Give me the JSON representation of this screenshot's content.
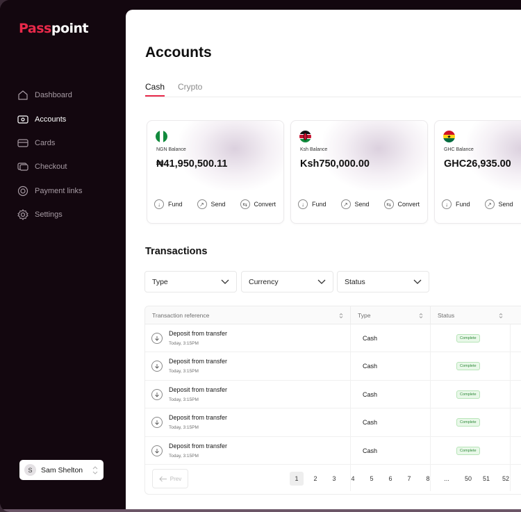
{
  "brand": {
    "logo_accent": "Pass",
    "logo_rest": "point",
    "accent_color": "#e8294a"
  },
  "sidebar": {
    "items": [
      {
        "label": "Dashboard",
        "icon": "home-icon"
      },
      {
        "label": "Accounts",
        "icon": "wallet-icon",
        "active": true
      },
      {
        "label": "Cards",
        "icon": "card-icon"
      },
      {
        "label": "Checkout",
        "icon": "checkout-icon"
      },
      {
        "label": "Payment links",
        "icon": "link-icon"
      },
      {
        "label": "Settings",
        "icon": "gear-icon"
      }
    ],
    "user": {
      "initial": "S",
      "name": "Sam Shelton"
    }
  },
  "main": {
    "title": "Accounts",
    "tabs": [
      {
        "label": "Cash",
        "active": true
      },
      {
        "label": "Crypto"
      }
    ],
    "cards": [
      {
        "flag": "nigeria-flag-icon",
        "label": "NGN Balance",
        "amount": "₦41,950,500.11",
        "actions": [
          "Fund",
          "Send",
          "Convert"
        ]
      },
      {
        "flag": "kenya-flag-icon",
        "label": "Ksh Balance",
        "amount": "Ksh750,000.00",
        "actions": [
          "Fund",
          "Send",
          "Convert"
        ]
      },
      {
        "flag": "ghana-flag-icon",
        "label": "GHC Balance",
        "amount": "GHC26,935.00",
        "actions": [
          "Fund",
          "Send"
        ]
      }
    ],
    "transactions": {
      "title": "Transactions",
      "filters": [
        "Type",
        "Currency",
        "Status"
      ],
      "columns": [
        "Transaction reference",
        "Type",
        "Status"
      ],
      "rows": [
        {
          "desc": "Deposit from transfer",
          "when": "Today, 3:15PM",
          "type": "Cash",
          "status": "Complete"
        },
        {
          "desc": "Deposit from transfer",
          "when": "Today, 3:15PM",
          "type": "Cash",
          "status": "Complete"
        },
        {
          "desc": "Deposit from transfer",
          "when": "Today, 3:15PM",
          "type": "Cash",
          "status": "Complete"
        },
        {
          "desc": "Deposit from transfer",
          "when": "Today, 3:15PM",
          "type": "Cash",
          "status": "Complete"
        },
        {
          "desc": "Deposit from transfer",
          "when": "Today, 3:15PM",
          "type": "Cash",
          "status": "Complete"
        }
      ],
      "pager": {
        "prev_label": "Prev",
        "pages": [
          "1",
          "2",
          "3",
          "4",
          "5",
          "6",
          "7",
          "8",
          "...",
          "50",
          "51",
          "52"
        ],
        "current": "1"
      }
    }
  }
}
